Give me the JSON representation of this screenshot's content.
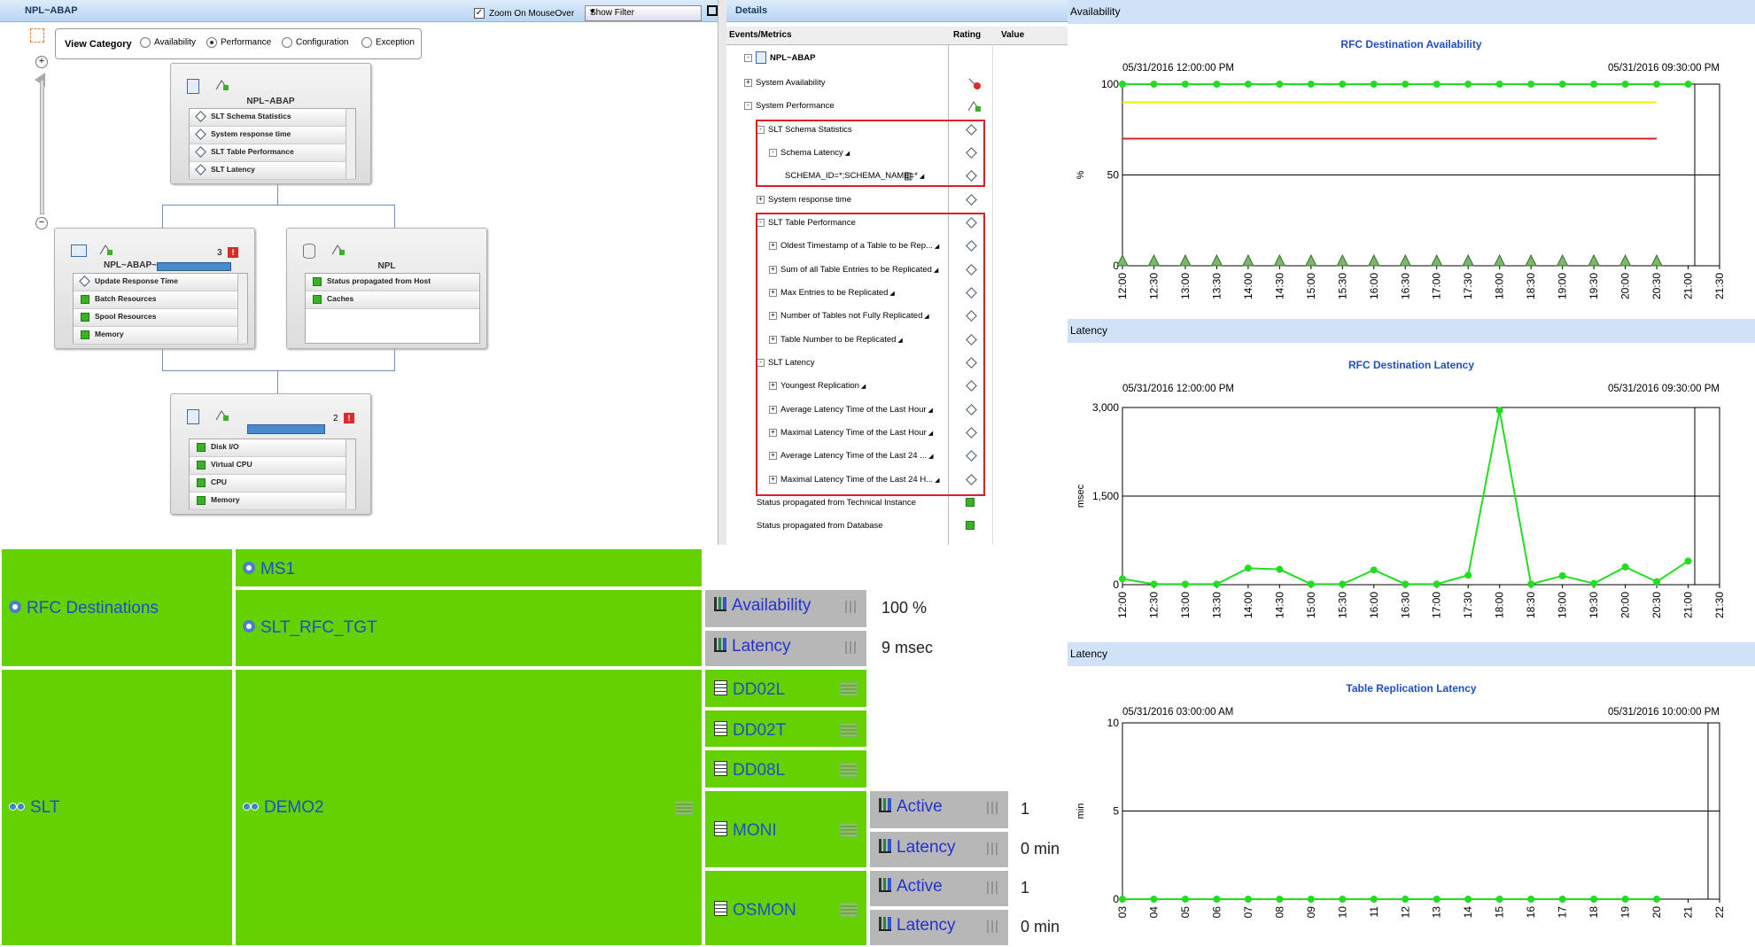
{
  "topology": {
    "title": "NPL~ABAP",
    "zoom_label": "Zoom On MouseOver",
    "filter_value": "Show Filter",
    "view_category": {
      "label": "View Category",
      "options": [
        "Availability",
        "Performance",
        "Configuration",
        "Exception"
      ],
      "selected": "Performance"
    },
    "nodes": {
      "top": {
        "title": "NPL~ABAP",
        "items": [
          "SLT Schema Statistics",
          "System response time",
          "SLT Table Performance",
          "SLT Latency"
        ]
      },
      "left": {
        "title": "NPL~ABAP~",
        "badge": "3",
        "items": [
          "Update Response Time",
          "Batch Resources",
          "Spool Resources",
          "Memory"
        ]
      },
      "right": {
        "title": "NPL",
        "items": [
          "Status propagated from Host",
          "Caches"
        ]
      },
      "bottom": {
        "badge": "2",
        "items": [
          "Disk I/O",
          "Virtual CPU",
          "CPU",
          "Memory"
        ]
      }
    }
  },
  "details": {
    "title": "Details",
    "headers": {
      "events": "Events/Metrics",
      "rating": "Rating",
      "value": "Value"
    },
    "root": "NPL~ABAP",
    "rows": [
      "System Availability",
      "System Performance",
      "SLT Schema Statistics",
      "Schema Latency",
      "SCHEMA_ID=*;SCHEMA_NAME=*",
      "System response time",
      "SLT Table Performance",
      "Oldest Timestamp of a Table to be Rep...",
      "Sum of all Table Entries to be Replicated",
      "Max Entries to be Replicated",
      "Number of Tables not Fully Replicated",
      "Table Number to be Replicated",
      "SLT Latency",
      "Youngest Replication",
      "Average Latency Time of the Last Hour",
      "Maximal Latency Time of the Last Hour",
      "Average Latency Time of the Last 24 ...",
      "Maximal Latency Time of the Last 24 H...",
      "Status propagated from Technical Instance",
      "Status propagated from Database"
    ]
  },
  "treemap": {
    "rfc_destinations": "RFC Destinations",
    "ms1": "MS1",
    "slt_rfc_tgt": "SLT_RFC_TGT",
    "availability": {
      "label": "Availability",
      "value": "100 %"
    },
    "latency": {
      "label": "Latency",
      "value": "9 msec"
    },
    "slt": "SLT",
    "demo2": "DEMO2",
    "tables": [
      "DD02L",
      "DD02T",
      "DD08L"
    ],
    "moni": {
      "label": "MONI",
      "active_label": "Active",
      "active_value": "1",
      "latency_label": "Latency",
      "latency_value": "0 min"
    },
    "osmon": {
      "label": "OSMON",
      "active_label": "Active",
      "active_value": "1",
      "latency_label": "Latency",
      "latency_value": "0 min"
    }
  },
  "charts": {
    "availability": {
      "section": "Availability"
    },
    "latency": {
      "section": "Latency"
    },
    "replication": {
      "section": "Latency"
    }
  },
  "chart_data": [
    {
      "type": "line",
      "title": "RFC Destination Availability",
      "start_label": "05/31/2016 12:00:00 PM",
      "end_label": "05/31/2016 09:30:00 PM",
      "ylabel": "%",
      "ylim": [
        0,
        100
      ],
      "yticks": [
        "0",
        "50",
        "100"
      ],
      "x": [
        "12:00",
        "12:30",
        "13:00",
        "13:30",
        "14:00",
        "14:30",
        "15:00",
        "15:30",
        "16:00",
        "16:30",
        "17:00",
        "17:30",
        "18:00",
        "18:30",
        "19:00",
        "19:30",
        "20:00",
        "20:30",
        "21:00",
        "21:30"
      ],
      "series": [
        {
          "values": [
            100,
            100,
            100,
            100,
            100,
            100,
            100,
            100,
            100,
            100,
            100,
            100,
            100,
            100,
            100,
            100,
            100,
            100,
            100
          ],
          "color": "#22dd22"
        }
      ],
      "thresholds": [
        {
          "value": 90,
          "color": "#f0f000"
        },
        {
          "value": 70,
          "color": "#e02020"
        }
      ],
      "grid": true
    },
    {
      "type": "line",
      "title": "RFC Destination Latency",
      "start_label": "05/31/2016 12:00:00 PM",
      "end_label": "05/31/2016 09:30:00 PM",
      "ylabel": "msec",
      "ylim": [
        0,
        3000
      ],
      "yticks": [
        "0",
        "1,500",
        "3,000"
      ],
      "x": [
        "12:00",
        "12:30",
        "13:00",
        "13:30",
        "14:00",
        "14:30",
        "15:00",
        "15:30",
        "16:00",
        "16:30",
        "17:00",
        "17:30",
        "18:00",
        "18:30",
        "19:00",
        "19:30",
        "20:00",
        "20:30",
        "21:00",
        "21:30"
      ],
      "series": [
        {
          "values": [
            100,
            10,
            10,
            10,
            280,
            260,
            10,
            10,
            250,
            10,
            10,
            160,
            2950,
            10,
            150,
            20,
            300,
            50,
            400
          ],
          "color": "#22dd22"
        }
      ],
      "grid": true
    },
    {
      "type": "line",
      "title": "Table Replication Latency",
      "start_label": "05/31/2016 03:00:00 AM",
      "end_label": "05/31/2016 10:00:00 PM",
      "ylabel": "min",
      "ylim": [
        0,
        10
      ],
      "yticks": [
        "0",
        "5",
        "10"
      ],
      "x": [
        "03",
        "04",
        "05",
        "06",
        "07",
        "08",
        "09",
        "10",
        "11",
        "12",
        "13",
        "14",
        "15",
        "16",
        "17",
        "18",
        "19",
        "20",
        "21",
        "22"
      ],
      "series": [
        {
          "values": [
            0,
            0,
            0,
            0,
            0,
            0,
            0,
            0,
            0,
            0,
            0,
            0,
            0,
            0,
            0,
            0,
            0,
            0
          ],
          "color": "#22dd22"
        }
      ],
      "grid": true
    }
  ]
}
